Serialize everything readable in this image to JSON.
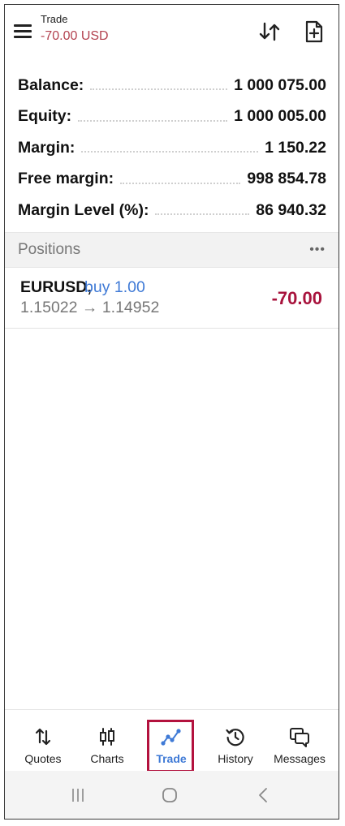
{
  "header": {
    "title": "Trade",
    "subtitle": "-70.00 USD",
    "subtitle_color": "#b3424f",
    "icons": [
      "menu-icon",
      "sort-icon",
      "new-document-icon"
    ]
  },
  "summary": [
    {
      "label": "Balance:",
      "value": "1 000 075.00"
    },
    {
      "label": "Equity:",
      "value": "1 000 005.00"
    },
    {
      "label": "Margin:",
      "value": "1 150.22"
    },
    {
      "label": "Free margin:",
      "value": "998 854.78"
    },
    {
      "label": "Margin Level (%):",
      "value": "86 940.32"
    }
  ],
  "positions": {
    "header": "Positions",
    "more_icon": "•••",
    "items": [
      {
        "symbol": "EURUSD,",
        "type": "buy 1.00",
        "prices": "1.15022 → 1.14952",
        "profit": "-70.00",
        "profit_color": "#a8133d"
      }
    ]
  },
  "nav": {
    "items": [
      {
        "label": "Quotes",
        "icon": "quotes-icon"
      },
      {
        "label": "Charts",
        "icon": "charts-icon"
      },
      {
        "label": "Trade",
        "icon": "trade-icon",
        "active": true
      },
      {
        "label": "History",
        "icon": "history-icon"
      },
      {
        "label": "Messages",
        "icon": "messages-icon"
      }
    ],
    "accent_color": "#3f7ad6",
    "highlight_color": "#b3123e"
  },
  "system_bar": {
    "icons": [
      "recent-apps-icon",
      "home-icon",
      "back-icon"
    ]
  }
}
